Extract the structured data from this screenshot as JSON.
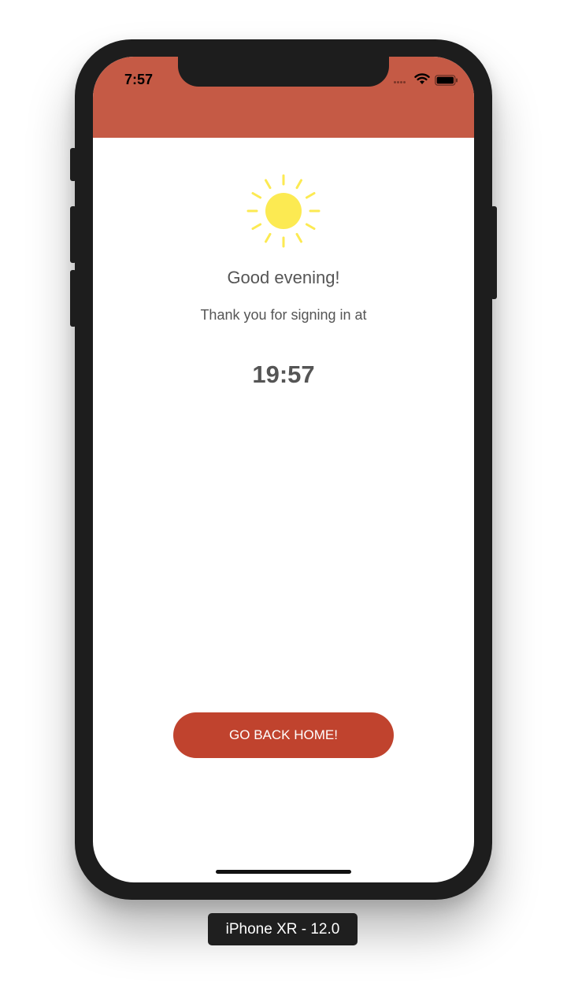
{
  "status_bar": {
    "time": "7:57"
  },
  "content": {
    "greeting": "Good evening!",
    "subtitle": "Thank you for signing in at",
    "time": "19:57"
  },
  "actions": {
    "go_home_label": "GO BACK HOME!"
  },
  "device_label": "iPhone XR - 12.0",
  "colors": {
    "header": "#c55a45",
    "button": "#c0432e",
    "sun": "#fcea52",
    "text": "#555555"
  },
  "icons": {
    "sun": "sun-icon",
    "wifi": "wifi-icon",
    "battery": "battery-icon",
    "signal": "signal-icon"
  }
}
